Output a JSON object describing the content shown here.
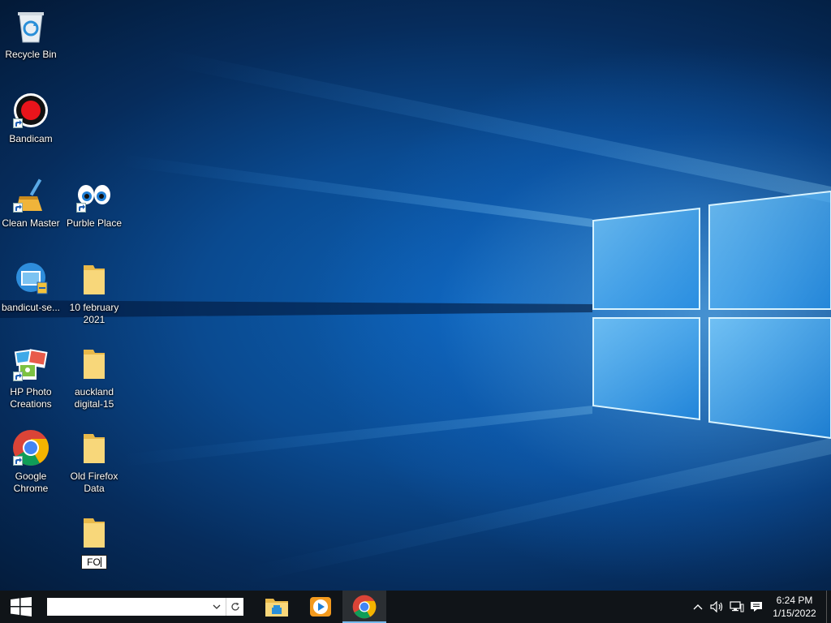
{
  "desktop": {
    "icons": [
      {
        "label": "Recycle Bin"
      },
      {
        "label": "Bandicam"
      },
      {
        "label": "Clean Master"
      },
      {
        "label": "Purble Place"
      },
      {
        "label": "bandicut-se..."
      },
      {
        "label": "10 february\n2021"
      },
      {
        "label": "HP Photo\nCreations"
      },
      {
        "label": "auckland\ndigital-15"
      },
      {
        "label": "Google\nChrome"
      },
      {
        "label": "Old Firefox\nData"
      }
    ],
    "rename_folder": {
      "value": "FO"
    }
  },
  "taskbar": {
    "search": {
      "value": "",
      "placeholder": ""
    },
    "apps": [
      "file-explorer",
      "media-player",
      "google-chrome"
    ],
    "clock": {
      "time": "6:24 PM",
      "date": "1/15/2022"
    }
  },
  "colors": {
    "taskbar": "#101418",
    "accent": "#76b9ed",
    "folder": "#f6d36b"
  }
}
